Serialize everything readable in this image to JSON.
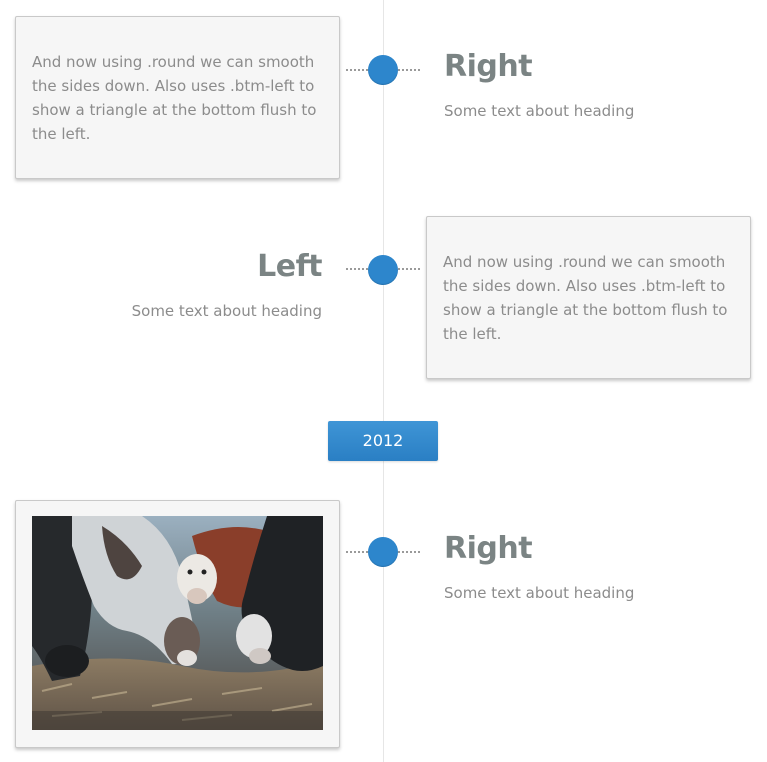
{
  "timeline": {
    "entries": [
      {
        "card_text": "And now using .round we can smooth the sides down. Also uses .btm-left to show a triangle at the bottom flush to the left.",
        "heading": "Right",
        "subtext": "Some text about heading"
      },
      {
        "card_text": "And now using .round we can smooth the sides down. Also uses .btm-left to show a triangle at the bottom flush to the left.",
        "heading": "Left",
        "subtext": "Some text about heading"
      },
      {
        "heading": "Right",
        "subtext": "Some text about heading"
      }
    ],
    "year_label": "2012"
  },
  "colors": {
    "accent": "#2d86cc",
    "heading": "#7b8484",
    "body_text": "#8c8c8c",
    "card_bg": "#f6f6f6",
    "line": "#e6e6e6"
  },
  "icons": {
    "timeline_marker": "circle-dot-icon",
    "photo": "cows-grazing-photo"
  }
}
